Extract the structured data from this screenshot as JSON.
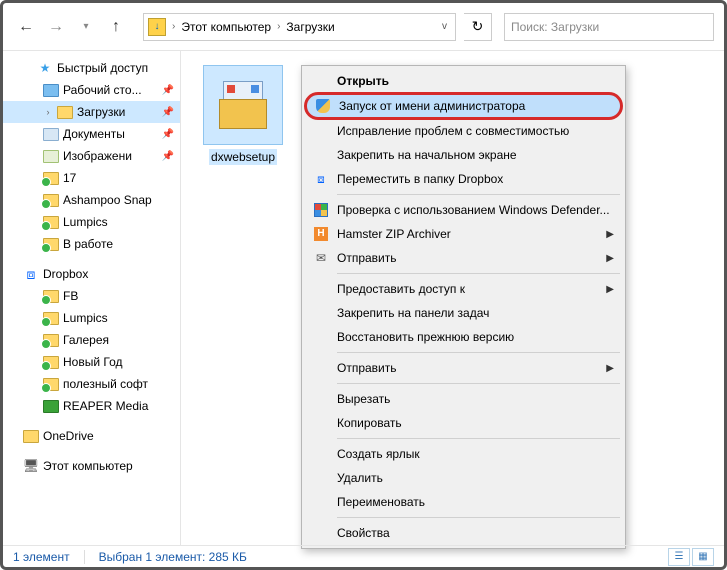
{
  "breadcrumb": {
    "root": "Этот компьютер",
    "current": "Загрузки"
  },
  "search": {
    "placeholder": "Поиск: Загрузки"
  },
  "sidebar": {
    "quick_access": "Быстрый доступ",
    "desktop": "Рабочий сто...",
    "downloads": "Загрузки",
    "documents": "Документы",
    "pictures": "Изображени",
    "folder17": "17",
    "ashampoo": "Ashampoo Snap",
    "lumpics": "Lumpics",
    "work": "В работе",
    "dropbox": "Dropbox",
    "fb": "FB",
    "lumpics2": "Lumpics",
    "gallery": "Галерея",
    "newyear": "Новый Год",
    "useful": "полезный софт",
    "reaper": "REAPER Media",
    "onedrive": "OneDrive",
    "thispc": "Этот компьютер"
  },
  "file": {
    "name": "dxwebsetup"
  },
  "context_menu": {
    "open": "Открыть",
    "run_as_admin": "Запуск от имени администратора",
    "compat": "Исправление проблем с совместимостью",
    "pin_start": "Закрепить на начальном экране",
    "move_dropbox": "Переместить в папку Dropbox",
    "defender": "Проверка с использованием Windows Defender...",
    "hamster": "Hamster ZIP Archiver",
    "send_to": "Отправить",
    "grant_access": "Предоставить доступ к",
    "pin_taskbar": "Закрепить на панели задач",
    "restore": "Восстановить прежнюю версию",
    "send_to2": "Отправить",
    "cut": "Вырезать",
    "copy": "Копировать",
    "shortcut": "Создать ярлык",
    "delete": "Удалить",
    "rename": "Переименовать",
    "properties": "Свойства"
  },
  "status": {
    "count": "1 элемент",
    "selection": "Выбран 1 элемент: 285 КБ"
  }
}
